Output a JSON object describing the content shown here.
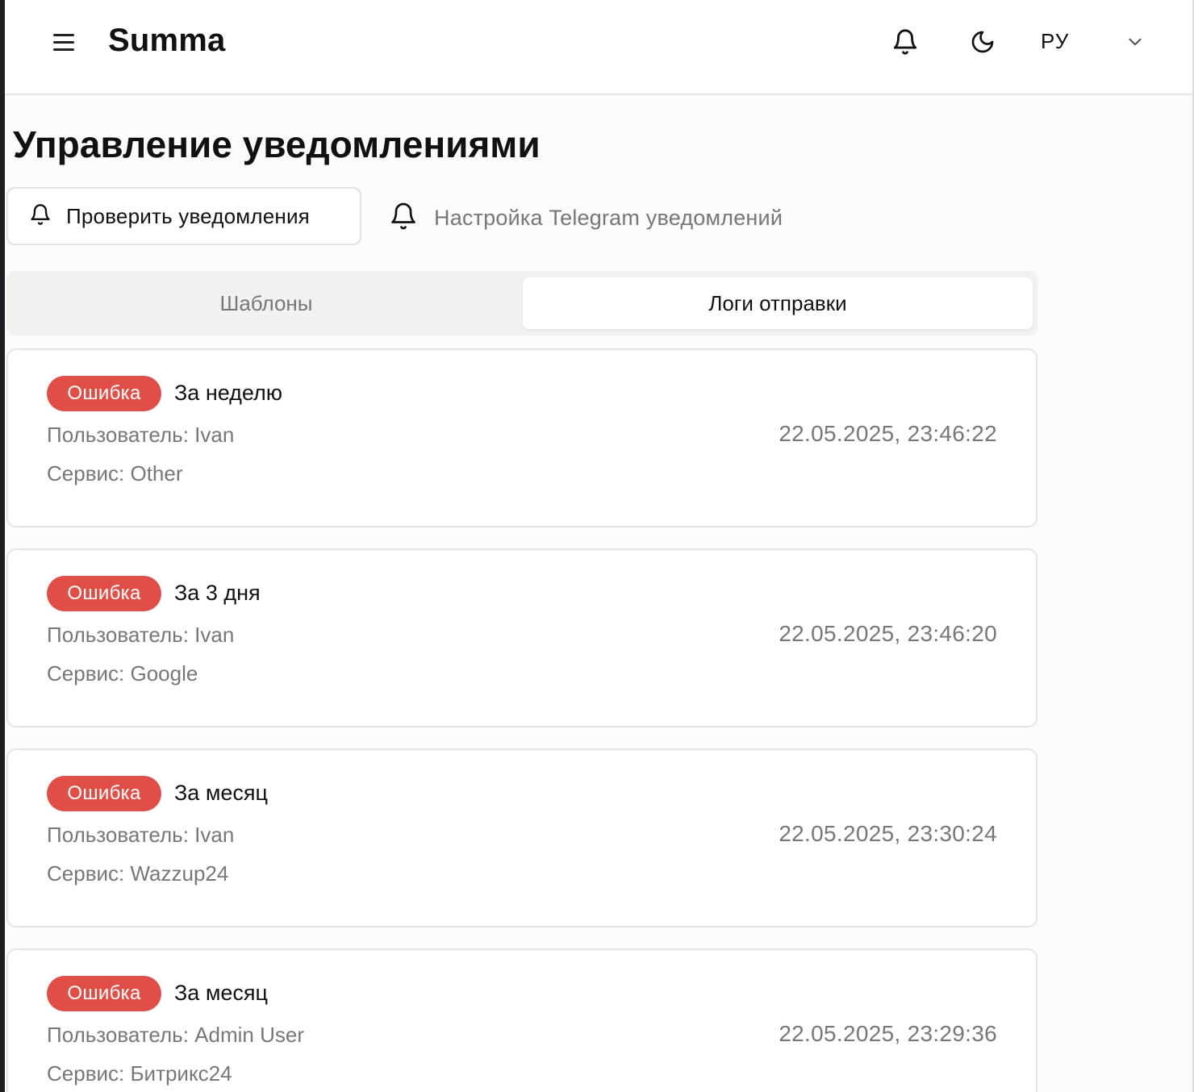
{
  "header": {
    "app_title": "Summa",
    "language": "РУ",
    "icons": {
      "menu": "menu-icon",
      "bell": "bell-icon",
      "theme": "moon-icon",
      "chevron": "chevron-down-icon"
    }
  },
  "page": {
    "title": "Управление уведомлениями",
    "check_button_label": "Проверить уведомления",
    "telegram_link_label": "Настройка Telegram уведомлений"
  },
  "tabs": [
    {
      "label": "Шаблоны",
      "active": false
    },
    {
      "label": "Логи отправки",
      "active": true
    }
  ],
  "logs": [
    {
      "status": "Ошибка",
      "period": "За неделю",
      "user": "Пользователь: Ivan",
      "service": "Сервис: Other",
      "timestamp": "22.05.2025, 23:46:22"
    },
    {
      "status": "Ошибка",
      "period": "За 3 дня",
      "user": "Пользователь: Ivan",
      "service": "Сервис: Google",
      "timestamp": "22.05.2025, 23:46:20"
    },
    {
      "status": "Ошибка",
      "period": "За месяц",
      "user": "Пользователь: Ivan",
      "service": "Сервис: Wazzup24",
      "timestamp": "22.05.2025, 23:30:24"
    },
    {
      "status": "Ошибка",
      "period": "За месяц",
      "user": "Пользователь: Admin User",
      "service": "Сервис: Битрикс24",
      "timestamp": "22.05.2025, 23:29:36"
    }
  ],
  "colors": {
    "error_badge": "#e04f47",
    "muted_text": "#777777",
    "page_bg": "#fbfbfb"
  }
}
